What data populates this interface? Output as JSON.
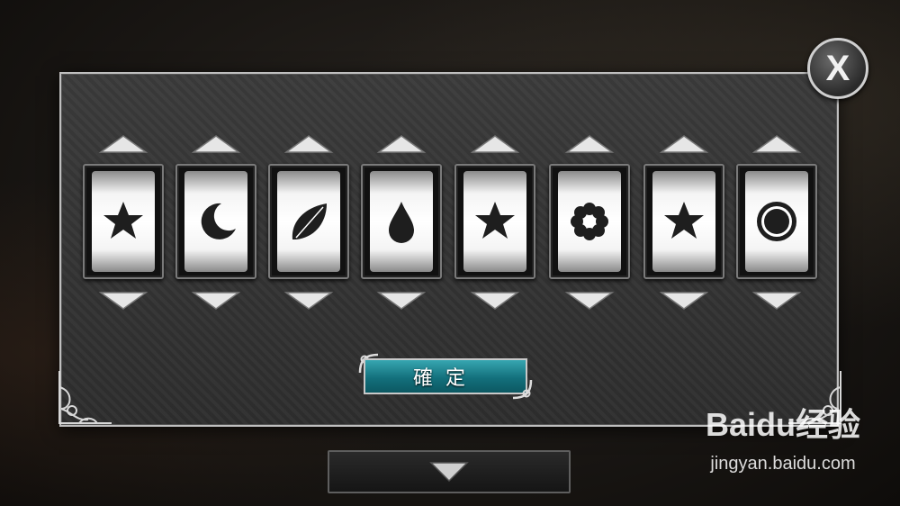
{
  "dialog": {
    "close_label": "X",
    "confirm_label": "確定"
  },
  "reels": [
    {
      "symbol": "star-icon"
    },
    {
      "symbol": "moon-icon"
    },
    {
      "symbol": "leaf-icon"
    },
    {
      "symbol": "drop-icon"
    },
    {
      "symbol": "star-icon"
    },
    {
      "symbol": "flower-icon"
    },
    {
      "symbol": "star-icon"
    },
    {
      "symbol": "sun-icon"
    }
  ],
  "colors": {
    "confirm_button": "#13707c",
    "symbol": "#1e1e1e",
    "reel_face": "#ffffff"
  },
  "watermark": {
    "logo": "Baidu经验",
    "url": "jingyan.baidu.com"
  }
}
